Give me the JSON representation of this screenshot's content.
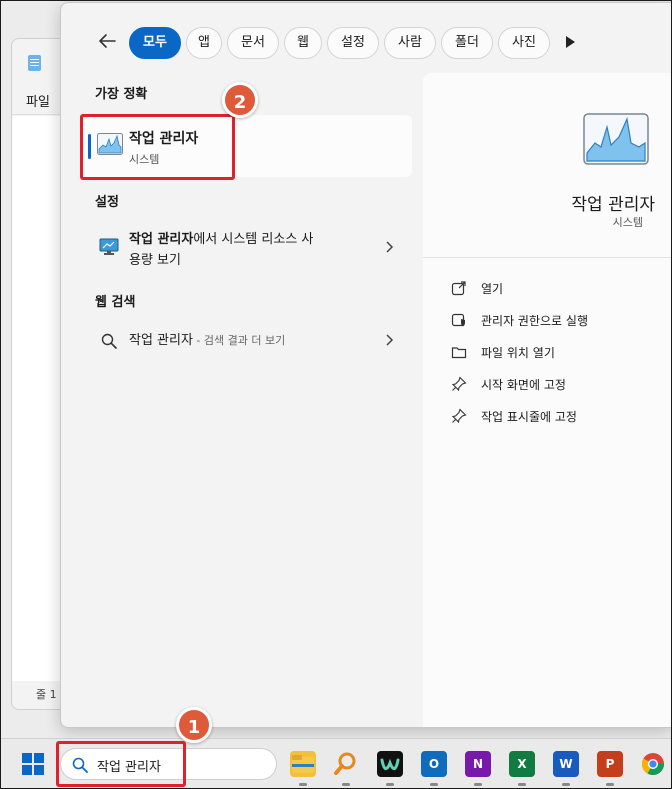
{
  "background_window": {
    "menu_label": "파일",
    "status_text": "줄 1"
  },
  "filter_tabs": [
    "모두",
    "앱",
    "문서",
    "웹",
    "설정",
    "사람",
    "폴더",
    "사진"
  ],
  "best_match": {
    "heading": "가장 정확",
    "title": "작업 관리자",
    "subtitle": "시스템"
  },
  "settings": {
    "heading": "설정",
    "item_bold": "작업 관리자",
    "item_rest": "에서 시스템 리소스 사",
    "item_line2": "용량 보기"
  },
  "web_search": {
    "heading": "웹 검색",
    "query": "작업 관리자",
    "suffix": " - 검색 결과 더 보기"
  },
  "detail": {
    "title": "작업 관리자",
    "subtitle": "시스템",
    "actions": [
      {
        "label": "열기",
        "icon": "open-external-icon"
      },
      {
        "label": "관리자 권한으로 실행",
        "icon": "shield-admin-icon"
      },
      {
        "label": "파일 위치 열기",
        "icon": "folder-icon"
      },
      {
        "label": "시작 화면에 고정",
        "icon": "pin-icon"
      },
      {
        "label": "작업 표시줄에 고정",
        "icon": "pin-icon"
      }
    ]
  },
  "taskbar": {
    "search_value": "작업 관리자",
    "apps": [
      "file-explorer",
      "search-magnifier",
      "webex",
      "outlook",
      "onenote",
      "excel",
      "word",
      "powerpoint",
      "chrome"
    ]
  },
  "annotations": {
    "badge_1": "1",
    "badge_2": "2"
  },
  "colors": {
    "accent": "#0a67c5",
    "highlight_red": "#e0202c",
    "badge_orange": "#df5a3a"
  }
}
